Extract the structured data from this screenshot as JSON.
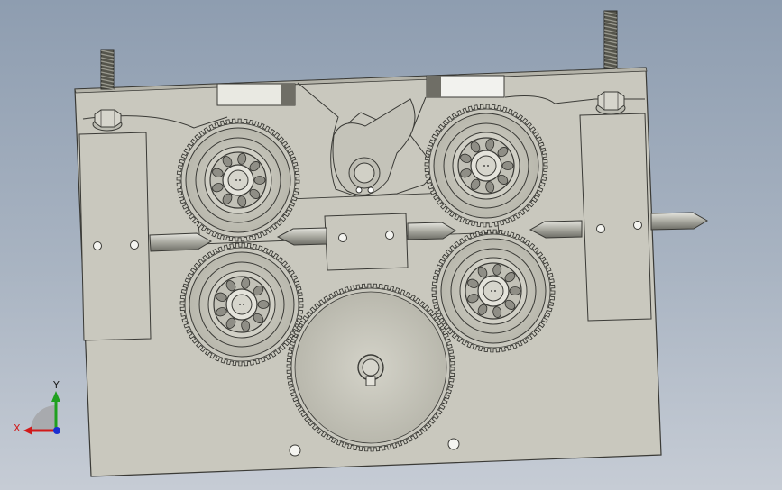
{
  "viewport": {
    "background_top": "#8e9db0",
    "background_bottom": "#c6ccd5",
    "model_color": "#c9c8be",
    "edge_color": "#3a3a36",
    "rod_color": "#5c5c52"
  },
  "triad": {
    "x_label": "X",
    "y_label": "Y",
    "x_color": "#d11a1a",
    "y_color": "#1fa01f",
    "z_color": "#1a2fd1"
  }
}
